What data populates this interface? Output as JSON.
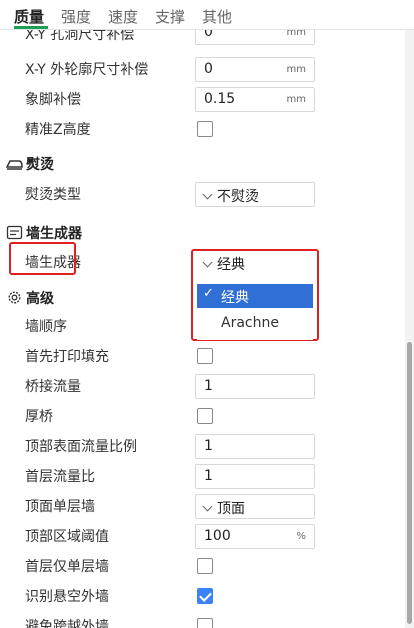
{
  "tabs": [
    {
      "label": "质量",
      "active": true
    },
    {
      "label": "强度",
      "active": false
    },
    {
      "label": "速度",
      "active": false
    },
    {
      "label": "支撑",
      "active": false
    },
    {
      "label": "其他",
      "active": false
    }
  ],
  "rows_top": {
    "hole_comp": {
      "label": "X-Y 孔洞尺寸补偿",
      "value": "0",
      "unit": "mm"
    },
    "contour_comp": {
      "label": "X-Y 外轮廓尺寸补偿",
      "value": "0",
      "unit": "mm"
    },
    "elephant_foot": {
      "label": "象脚补偿",
      "value": "0.15",
      "unit": "mm"
    },
    "precise_z": {
      "label": "精准Z高度",
      "checked": false
    }
  },
  "ironing": {
    "title": "熨烫",
    "icon": "iron-icon",
    "type_label": "熨烫类型",
    "type_value": "不熨烫"
  },
  "wall_generator": {
    "title": "墙生成器",
    "icon": "wall-icon",
    "label": "墙生成器",
    "value": "经典",
    "options": [
      "经典",
      "Arachne"
    ],
    "selected_index": 0
  },
  "advanced": {
    "title": "高级",
    "icon": "gear-icon",
    "wall_order": {
      "label": "墙顺序"
    },
    "print_infill_first": {
      "label": "首先打印填充",
      "checked": false
    },
    "bridge_flow": {
      "label": "桥接流量",
      "value": "1"
    },
    "thick_bridges": {
      "label": "厚桥",
      "checked": false
    },
    "top_surface_flow": {
      "label": "顶部表面流量比例",
      "value": "1"
    },
    "first_layer_flow": {
      "label": "首层流量比",
      "value": "1"
    },
    "top_single_wall": {
      "label": "顶面单层墙",
      "value": "顶面"
    },
    "top_area_threshold": {
      "label": "顶部区域阈值",
      "value": "100",
      "unit": "%"
    },
    "first_layer_single_wall": {
      "label": "首层仅单层墙",
      "checked": false
    },
    "detect_overhang": {
      "label": "识别悬空外墙",
      "checked": true
    },
    "avoid_crossing": {
      "label": "避免跨越外墙",
      "checked": false
    }
  },
  "colors": {
    "accent": "#1b9e55",
    "highlight": "#e02020",
    "selection": "#2f6fd6",
    "checkbox_checked": "#3b82f6"
  }
}
